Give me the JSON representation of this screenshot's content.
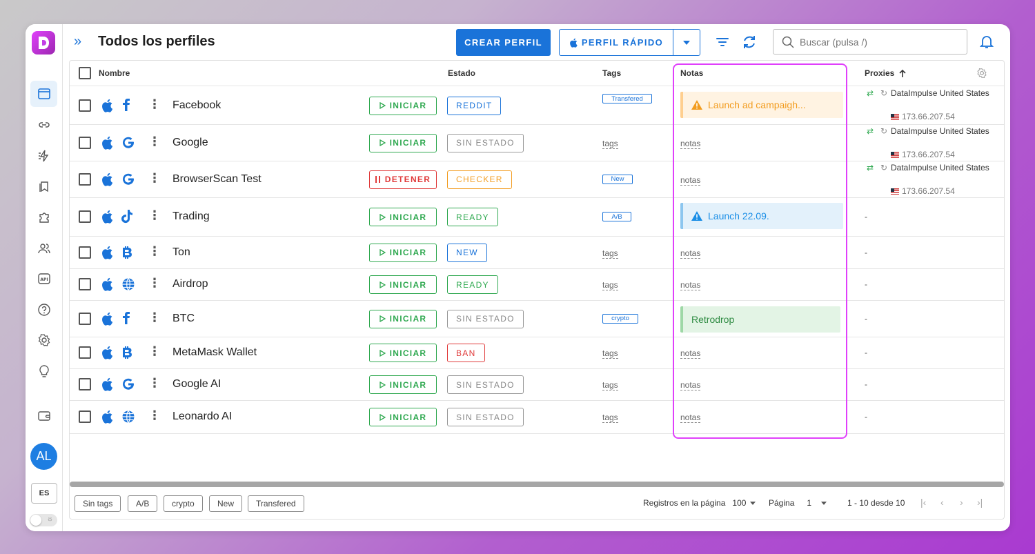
{
  "header": {
    "title": "Todos los perfiles",
    "create_label": "CREAR PERFIL",
    "quick_label": "PERFIL RÁPIDO",
    "search_placeholder": "Buscar (pulsa /)"
  },
  "sidebar": {
    "avatar": "AL",
    "lang": "ES"
  },
  "table": {
    "columns": {
      "name": "Nombre",
      "status": "Estado",
      "tags": "Tags",
      "notes": "Notas",
      "proxies": "Proxies"
    },
    "start_label": "INICIAR",
    "stop_label": "DETENER",
    "tags_placeholder": "tags",
    "notes_placeholder": "notas",
    "rows": [
      {
        "name": "Facebook",
        "icon": "facebook",
        "action": "INICIAR",
        "status": "REDDIT",
        "tag": "Transfered",
        "note": "Launch ad campaigh...",
        "note_kind": "warning",
        "proxy": "DataImpulse United States",
        "ip": "173.66.207.54"
      },
      {
        "name": "Google",
        "icon": "google",
        "action": "INICIAR",
        "status": "SIN ESTADO",
        "tag": "tags",
        "note": "notas",
        "note_kind": "empty",
        "proxy": "DataImpulse United States",
        "ip": "173.66.207.54"
      },
      {
        "name": "BrowserScan Test",
        "icon": "google",
        "action": "DETENER",
        "status": "CHECKER",
        "tag": "New",
        "note": "notas",
        "note_kind": "empty",
        "proxy": "DataImpulse United States",
        "ip": "173.66.207.54"
      },
      {
        "name": "Trading",
        "icon": "tiktok",
        "action": "INICIAR",
        "status": "READY",
        "tag": "A/B",
        "note": "Launch 22.09.",
        "note_kind": "info",
        "proxy": "-",
        "ip": ""
      },
      {
        "name": "Ton",
        "icon": "bitcoin",
        "action": "INICIAR",
        "status": "NEW",
        "tag": "tags",
        "note": "notas",
        "note_kind": "empty",
        "proxy": "-",
        "ip": ""
      },
      {
        "name": "Airdrop",
        "icon": "globe",
        "action": "INICIAR",
        "status": "READY",
        "tag": "tags",
        "note": "notas",
        "note_kind": "empty",
        "proxy": "-",
        "ip": ""
      },
      {
        "name": "BTC",
        "icon": "facebook",
        "action": "INICIAR",
        "status": "SIN ESTADO",
        "tag": "crypto",
        "note": "Retrodrop",
        "note_kind": "success",
        "proxy": "-",
        "ip": ""
      },
      {
        "name": "MetaMask Wallet",
        "icon": "bitcoin",
        "action": "INICIAR",
        "status": "BAN",
        "tag": "tags",
        "note": "notas",
        "note_kind": "empty",
        "proxy": "-",
        "ip": ""
      },
      {
        "name": "Google AI",
        "icon": "google",
        "action": "INICIAR",
        "status": "SIN ESTADO",
        "tag": "tags",
        "note": "notas",
        "note_kind": "empty",
        "proxy": "-",
        "ip": ""
      },
      {
        "name": "Leonardo AI",
        "icon": "globe",
        "action": "INICIAR",
        "status": "SIN ESTADO",
        "tag": "tags",
        "note": "notas",
        "note_kind": "empty",
        "proxy": "-",
        "ip": ""
      }
    ]
  },
  "footer": {
    "tag_filters": [
      "Sin tags",
      "A/B",
      "crypto",
      "New",
      "Transfered"
    ],
    "rows_per_page_label": "Registros en la página",
    "rows_per_page": "100",
    "page_label": "Página",
    "page": "1",
    "range": "1 - 10 desde 10"
  },
  "colors": {
    "accent": "#1a73d9",
    "start": "#2ea84f",
    "stop": "#e03a3a",
    "highlight": "#e040fb"
  }
}
